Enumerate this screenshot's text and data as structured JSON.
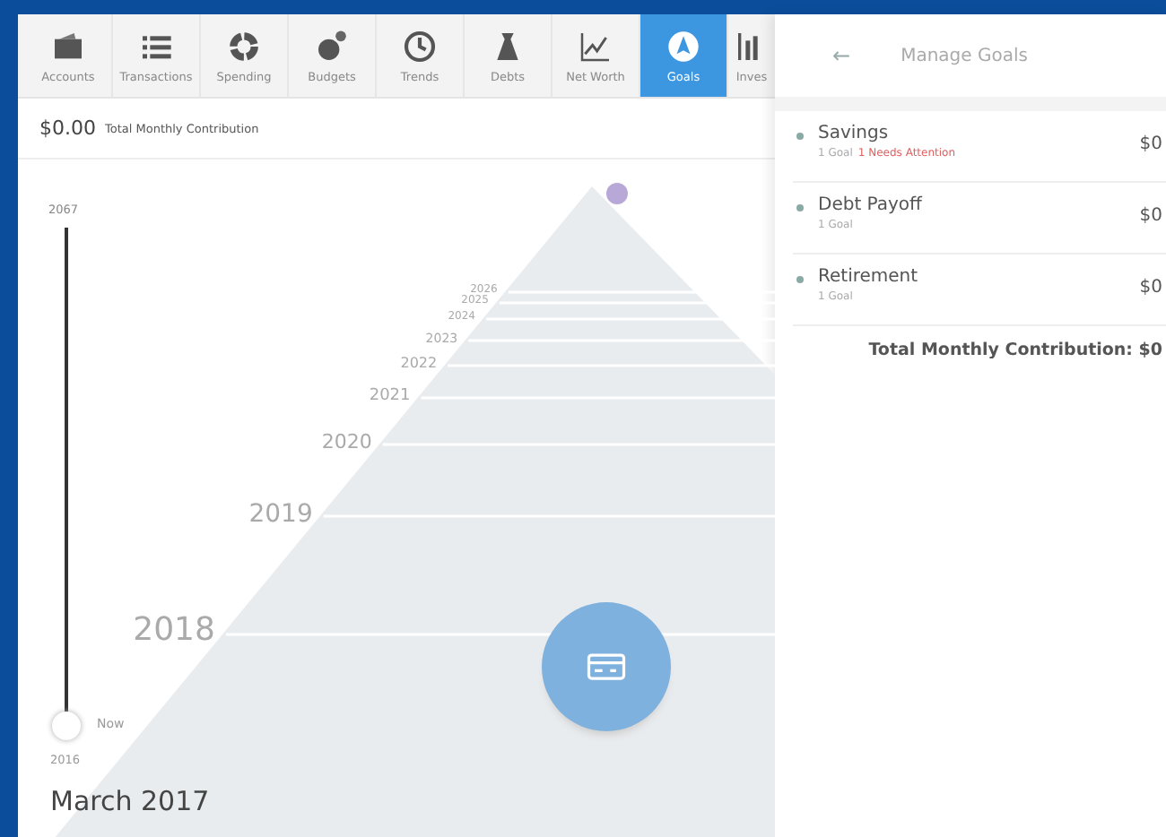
{
  "nav_tabs": [
    {
      "label": "Accounts",
      "selected": false
    },
    {
      "label": "Transactions",
      "selected": false
    },
    {
      "label": "Spending",
      "selected": false
    },
    {
      "label": "Budgets",
      "selected": false
    },
    {
      "label": "Trends",
      "selected": false
    },
    {
      "label": "Debts",
      "selected": false
    },
    {
      "label": "Net Worth",
      "selected": false
    },
    {
      "label": "Goals",
      "selected": true
    },
    {
      "label": "Inves",
      "selected": false
    }
  ],
  "contribution": {
    "amount": "$0.00",
    "label": "Total Monthly Contribution"
  },
  "timeline": {
    "top_year": "2067",
    "bottom_year": "2016",
    "now_label": "Now",
    "level": 0,
    "years": [
      "2018",
      "2019",
      "2020",
      "2021",
      "2022",
      "2023",
      "2024",
      "2025",
      "2026"
    ],
    "date": "March 2017"
  },
  "panel": {
    "back": "←",
    "title": "Manage Goals",
    "categories": [
      {
        "name": "Savings",
        "count": "1 Goal",
        "alert": "1 Needs Attention",
        "amount": "$0"
      },
      {
        "name": "Debt Payoff",
        "count": "1 Goal",
        "amount": "$0"
      },
      {
        "name": "Retirement",
        "count": "1 Goal",
        "amount": "$0"
      }
    ],
    "total": "Total Monthly Contribution: $0"
  }
}
